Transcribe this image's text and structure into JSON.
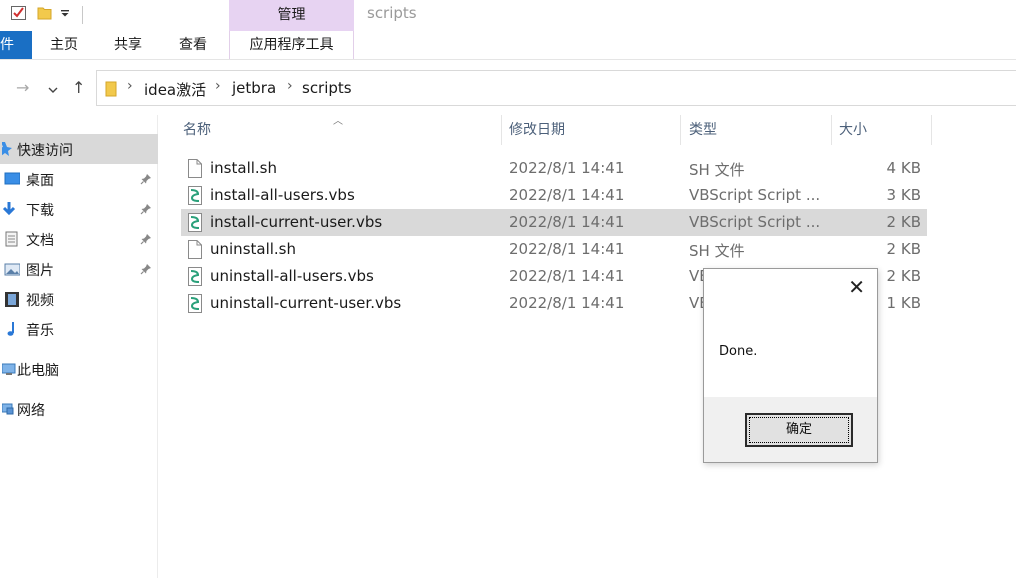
{
  "title_bar": {
    "contextual_tab_group": "管理",
    "window_title": "scripts"
  },
  "ribbon": {
    "tabs": [
      "件",
      "主页",
      "共享",
      "查看",
      "应用程序工具"
    ]
  },
  "address_bar": {
    "breadcrumbs": [
      "idea激活",
      "jetbra",
      "scripts"
    ]
  },
  "nav_pane": {
    "items": [
      {
        "label": "快速访问",
        "icon": "star-icon",
        "pinned": false,
        "selected": true
      },
      {
        "label": "桌面",
        "icon": "desktop-icon",
        "pinned": true,
        "selected": false
      },
      {
        "label": "下载",
        "icon": "download-icon",
        "pinned": true,
        "selected": false
      },
      {
        "label": "文档",
        "icon": "document-icon",
        "pinned": true,
        "selected": false
      },
      {
        "label": "图片",
        "icon": "picture-icon",
        "pinned": true,
        "selected": false
      },
      {
        "label": "视频",
        "icon": "video-icon",
        "pinned": false,
        "selected": false
      },
      {
        "label": "音乐",
        "icon": "music-icon",
        "pinned": false,
        "selected": false
      },
      {
        "label": "此电脑",
        "icon": "computer-icon",
        "pinned": false,
        "selected": false
      },
      {
        "label": "网络",
        "icon": "network-icon",
        "pinned": false,
        "selected": false
      }
    ]
  },
  "file_list": {
    "columns": [
      "名称",
      "修改日期",
      "类型",
      "大小"
    ],
    "rows": [
      {
        "name": "install.sh",
        "date": "2022/8/1 14:41",
        "type": "SH 文件",
        "size": "4 KB",
        "icon": "file-icon",
        "selected": false
      },
      {
        "name": "install-all-users.vbs",
        "date": "2022/8/1 14:41",
        "type": "VBScript Script ...",
        "size": "3 KB",
        "icon": "vbs-script-icon",
        "selected": false
      },
      {
        "name": "install-current-user.vbs",
        "date": "2022/8/1 14:41",
        "type": "VBScript Script ...",
        "size": "2 KB",
        "icon": "vbs-script-icon",
        "selected": true
      },
      {
        "name": "uninstall.sh",
        "date": "2022/8/1 14:41",
        "type": "SH 文件",
        "size": "2 KB",
        "icon": "file-icon",
        "selected": false
      },
      {
        "name": "uninstall-all-users.vbs",
        "date": "2022/8/1 14:41",
        "type": "VB",
        "size": "2 KB",
        "icon": "vbs-script-icon",
        "selected": false
      },
      {
        "name": "uninstall-current-user.vbs",
        "date": "2022/8/1 14:41",
        "type": "VE",
        "size": "1 KB",
        "icon": "vbs-script-icon",
        "selected": false
      }
    ]
  },
  "dialog": {
    "message": "Done.",
    "ok_label": "确定",
    "close_glyph": "✕"
  },
  "colors": {
    "file_tab_blue": "#1a6fc4",
    "contextual_tab_purple": "#e7d3f2",
    "selection_gray": "#d9d9d9"
  }
}
